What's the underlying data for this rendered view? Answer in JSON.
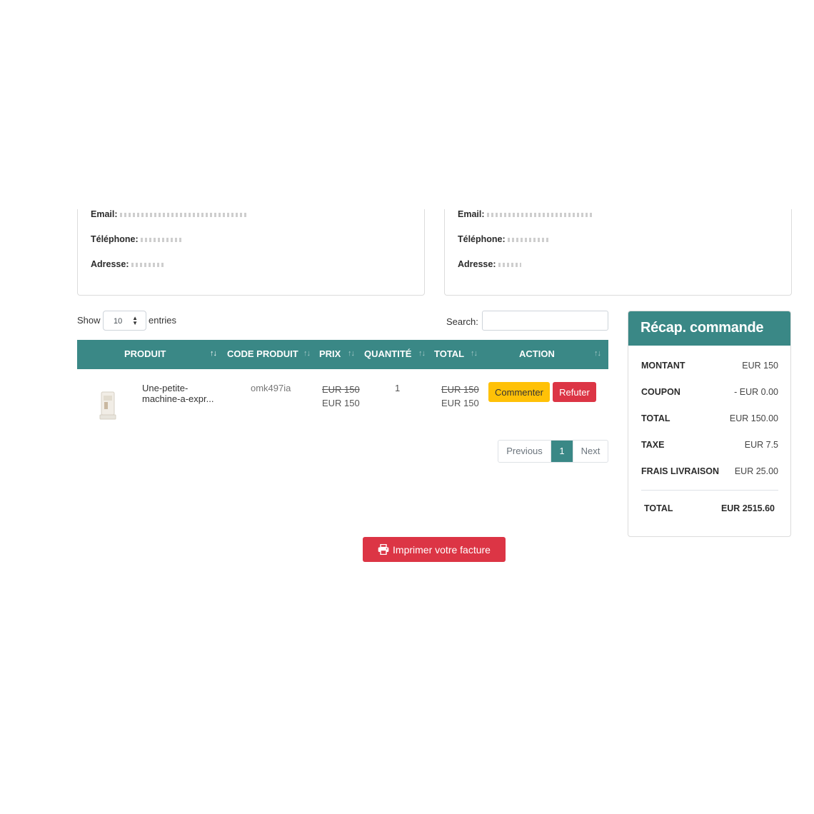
{
  "addresses": {
    "left": {
      "email_label": "Email:",
      "phone_label": "Téléphone:",
      "address_label": "Adresse:"
    },
    "right": {
      "email_label": "Email:",
      "phone_label": "Téléphone:",
      "address_label": "Adresse:"
    }
  },
  "table_controls": {
    "show_label": "Show",
    "entries_value": "10",
    "entries_label": "entries",
    "search_label": "Search:",
    "search_value": ""
  },
  "table": {
    "headers": [
      "PRODUIT",
      "CODE PRODUIT",
      "PRIX",
      "QUANTITÉ",
      "TOTAL",
      "ACTION"
    ],
    "rows": [
      {
        "product_line1": "Une-petite-",
        "product_line2": "machine-a-expr...",
        "code": "omk497ia",
        "price_old": "EUR 150",
        "price": "EUR 150",
        "quantity": "1",
        "total_old": "EUR 150",
        "total": "EUR 150",
        "action_comment": "Commenter",
        "action_refuse": "Refuter"
      }
    ]
  },
  "pagination": {
    "previous": "Previous",
    "current": "1",
    "next": "Next"
  },
  "recap": {
    "title": "Récap. commande",
    "rows": [
      {
        "label": "MONTANT",
        "value": "EUR 150"
      },
      {
        "label": "COUPON",
        "value": "- EUR 0.00"
      },
      {
        "label": "TOTAL",
        "value": "EUR 150.00"
      },
      {
        "label": "TAXE",
        "value": "EUR 7.5"
      },
      {
        "label": "FRAIS LIVRAISON",
        "value": "EUR 25.00"
      }
    ],
    "grand_total_label": "TOTAL",
    "grand_total_value": "EUR 2515.60"
  },
  "print_button": {
    "label": "Imprimer votre facture",
    "icon": "printer-icon"
  },
  "colors": {
    "teal": "#3a8886",
    "danger": "#dc3545",
    "warning": "#ffc107"
  }
}
